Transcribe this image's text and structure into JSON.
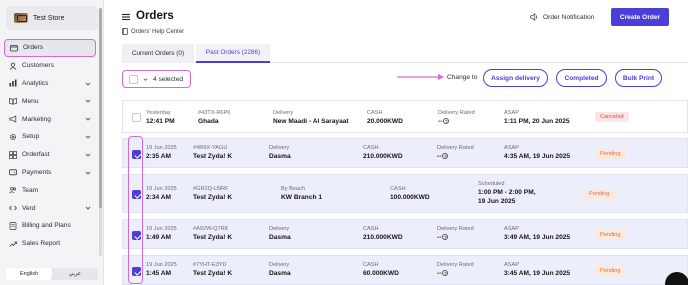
{
  "sidebar": {
    "store_name": "Test Store",
    "items": [
      {
        "label": "Orders",
        "icon": "orders-icon",
        "active": true
      },
      {
        "label": "Customers",
        "icon": "customers-icon"
      },
      {
        "label": "Analytics",
        "icon": "analytics-icon",
        "chevron": true
      },
      {
        "label": "Menu",
        "icon": "menu-book-icon",
        "chevron": true
      },
      {
        "label": "Marketing",
        "icon": "megaphone-icon",
        "chevron": true
      },
      {
        "label": "Setup",
        "icon": "gear-icon",
        "chevron": true
      },
      {
        "label": "Orderfast",
        "icon": "grid-icon",
        "chevron": true
      },
      {
        "label": "Payments",
        "icon": "wallet-icon",
        "chevron": true
      },
      {
        "label": "Team",
        "icon": "team-icon"
      },
      {
        "label": "Verd",
        "icon": "code-icon",
        "chevron": true
      },
      {
        "label": "Billing and Plans",
        "icon": "billing-icon"
      },
      {
        "label": "Sales Report",
        "icon": "trend-icon"
      }
    ],
    "languages": {
      "english": "English",
      "arabic": "عربي"
    }
  },
  "header": {
    "title": "Orders",
    "help_link": "Orders' Help Center",
    "notification": "Order Notification",
    "create_button": "Create Order"
  },
  "tabs": {
    "current": "Current Orders (0)",
    "past": "Past Orders (2286)"
  },
  "actions": {
    "selected_text": "4 selected",
    "change_to": "Change to",
    "assign": "Assign delivery",
    "completed": "Completed",
    "bulk_print": "Bulk Print"
  },
  "orders": [
    {
      "date": "Yesterday",
      "time": "12:41 PM",
      "id": "#43TX-R6P6",
      "customer": "Ghada",
      "type_label": "Delivery",
      "type_value": "New Maadi - Al Sarayaat",
      "pay_label": "CASH",
      "amount": "20.000KWD",
      "rated_label": "Delivery Rated",
      "rated_value": "--",
      "sched_label": "ASAP",
      "sched_value": "1:11 PM, 20 Jun 2025",
      "status": "Canceled",
      "checked": false
    },
    {
      "date": "19 Jun 2025",
      "time": "2:35 AM",
      "id": "#4R9X-YAGU",
      "customer": "Test Zyda! K",
      "type_label": "Delivery",
      "type_value": "Dasma",
      "pay_label": "CASH",
      "amount": "210.000KWD",
      "rated_label": "Delivery Rated",
      "rated_value": "--",
      "sched_label": "ASAP",
      "sched_value": "4:35 AM, 19 Jun 2025",
      "status": "Pending",
      "checked": true
    },
    {
      "date": "19 Jun 2025",
      "time": "2:34 AM",
      "id": "#GR2Q-U9RF",
      "customer": "Test Zyda! K",
      "type_label": "By Beach",
      "type_value": "KW Branch 1",
      "pay_label": "CASH",
      "amount": "100.000KWD",
      "rated_label": "",
      "rated_value": "",
      "sched_label": "Scheduled",
      "sched_value": "1:00 PM - 2:00 PM,",
      "sched_value2": "19 Jun 2025",
      "status": "Pending",
      "checked": true
    },
    {
      "date": "19 Jun 2025",
      "time": "1:49 AM",
      "id": "#A92W-Q7R8",
      "customer": "Test Zyda! K",
      "type_label": "Delivery",
      "type_value": "Dasma",
      "pay_label": "CASH",
      "amount": "210.000KWD",
      "rated_label": "Delivery Rated",
      "rated_value": "--",
      "sched_label": "ASAP",
      "sched_value": "3:49 AM, 19 Jun 2025",
      "status": "Pending",
      "checked": true
    },
    {
      "date": "19 Jun 2025",
      "time": "1:45 AM",
      "id": "#7YHT-E3YD",
      "customer": "Test Zyda! K",
      "type_label": "Delivery",
      "type_value": "Dasma",
      "pay_label": "CASH",
      "amount": "60.000KWD",
      "rated_label": "Delivery Rated",
      "rated_value": "--",
      "sched_label": "ASAP",
      "sched_value": "3:45 AM, 19 Jun 2025",
      "status": "Pending",
      "checked": true
    }
  ],
  "colors": {
    "accent": "#4a3fd6",
    "highlight": "#d66ad6",
    "canceled": "#c9554f",
    "pending": "#d0764a"
  }
}
